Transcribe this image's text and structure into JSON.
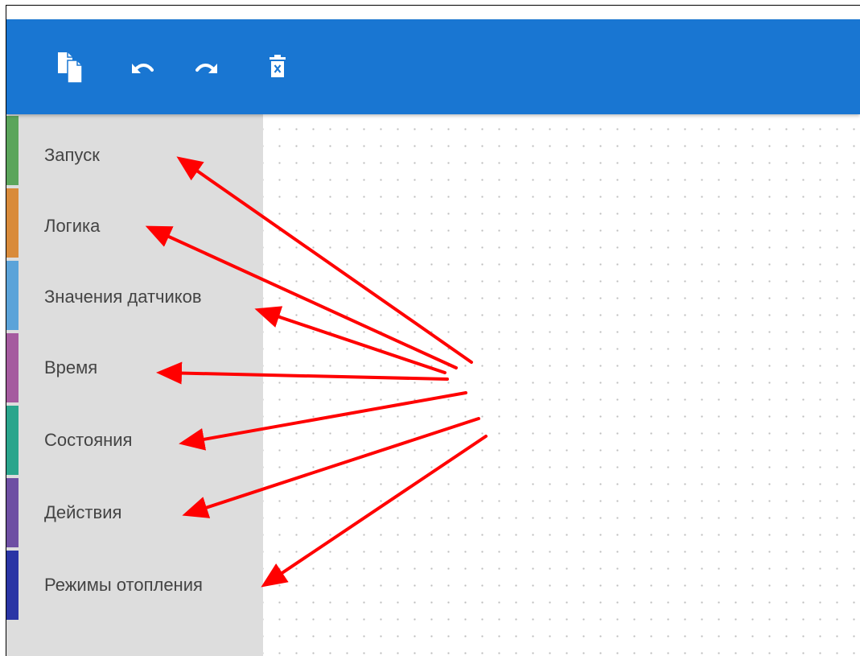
{
  "toolbar": {
    "color": "#1976d2",
    "buttons": [
      {
        "name": "copy-button",
        "icon": "copy-icon"
      },
      {
        "name": "undo-button",
        "icon": "undo-icon"
      },
      {
        "name": "redo-button",
        "icon": "redo-icon"
      },
      {
        "name": "delete-button",
        "icon": "trash-icon"
      }
    ]
  },
  "sidebar": {
    "background": "#dddddd",
    "categories": [
      {
        "label": "Запуск",
        "color": "#5ba55b"
      },
      {
        "label": "Логика",
        "color": "#d98b3a"
      },
      {
        "label": "Значения датчиков",
        "color": "#5ba3d9"
      },
      {
        "label": "Время",
        "color": "#a55b9f"
      },
      {
        "label": "Состояния",
        "color": "#2aa58c"
      },
      {
        "label": "Действия",
        "color": "#6e4fa3"
      },
      {
        "label": "Режимы отопления",
        "color": "#2a35a5"
      }
    ]
  },
  "annotation": {
    "arrow_color": "#ff0000"
  }
}
